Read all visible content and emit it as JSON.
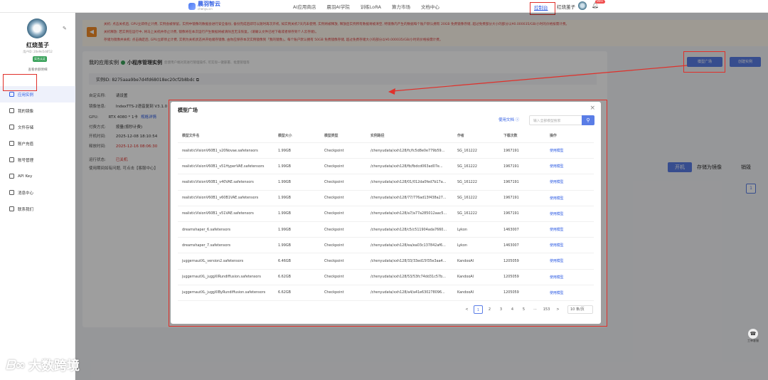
{
  "nav": {
    "logo_text": "晨羽智云",
    "logo_sub": "chenyu.cn",
    "links": [
      "AI应用商店",
      "晨羽AI学院",
      "训练LoRA",
      "算力市场",
      "文档中心"
    ],
    "console": "控制台",
    "username": "红烧茧子",
    "badge": "99+"
  },
  "sidebar": {
    "name": "红烧茧子",
    "user_id": "用户ID: 20e9e5d4f12",
    "tag": "实名认证",
    "link": "查看余额明细",
    "items": [
      {
        "label": "应用实例",
        "icon": "grid-icon",
        "active": true
      },
      {
        "label": "我的镜像",
        "icon": "box-icon"
      },
      {
        "label": "文件存储",
        "icon": "folder-icon"
      },
      {
        "label": "账户充值",
        "icon": "wallet-icon"
      },
      {
        "label": "账号管理",
        "icon": "user-icon"
      },
      {
        "label": "API Key",
        "icon": "key-icon"
      },
      {
        "label": "消息中心",
        "icon": "message-icon"
      },
      {
        "label": "联系我们",
        "icon": "contact-icon"
      }
    ]
  },
  "notice": {
    "lines": [
      "关机: 点击关机后, GPU立即停止计费, 实例会被保留。实例中镜像的数据会进行安全备份, 备份完成后即可以随时再次开机, 如实例关机7天内未使用, 实例将被释放, 释放后实例所有数据将被清空, 特镜像内产生的数据每个账户默认拥有 20GB 免费镜像存储, 超过免费部分大小的部分以¥0.000035/GB/小时的价格按需计费。",
      "关机释放: 若实例在运行中, 将马上关机并停止计费, 镜像将在本次运行产生数据将被清除且无法恢复。(请确认文件已经下载或者保存到个人云存储)。",
      "存储为镜像并关机: 点击确定后, GPU立即停止计费, 实例为关机状态并开始储存镜像, 由你应保存本次实例镜像到「我的镜像」。每个账户默认拥有 50GB 免费镜像存储, 超过免费存储大小的部分以¥0.000035/GB/小时的价格按需计费。"
    ]
  },
  "card": {
    "title": "我的应用实例",
    "mini": "小程序管理实例",
    "hint": "您使用户端对其进行管理操作, 可实现一键部署、批量管理等",
    "instance_label": "实例ID:",
    "instance_id": "8275aaa9be7d4fd68018ec20cf2b8bdc",
    "info": [
      {
        "label": "自定名称:",
        "value": "请设置"
      },
      {
        "label": "镜像信息:",
        "value": "IndexTTS-2语音复刻 V3.1.0"
      },
      {
        "label": "GPU:",
        "value": "RTX 4080 * 1卡",
        "link": "规格详情"
      },
      {
        "label": "付费方式:",
        "value": "按量(按秒计费)"
      },
      {
        "label": "开机时间:",
        "value": "2025-12-08 18:10:54"
      },
      {
        "label": "释放时间:",
        "value": "2025-12-16 08:06:30",
        "red": true
      },
      {
        "label": "运行状态:",
        "value": "已关机",
        "red": true
      }
    ],
    "help": "使用期间如有问题, 可点击【客服中心】",
    "btn_model": "模型广场",
    "btn_create": "创建实例",
    "btn_power": "开机",
    "btn_save": "存储为镜像",
    "btn_delete": "销毁",
    "page": "1"
  },
  "modal": {
    "title": "模型广场",
    "doc_link": "使用文档",
    "search_placeholder": "输入全部模型搜索",
    "columns": [
      "模型文件名",
      "模型大小",
      "模型类型",
      "实例路径",
      "作者",
      "下载次数",
      "操作"
    ],
    "rows": [
      [
        "realisticVisionV60B1_v20Novae.safetensors",
        "1.99GB",
        "Checkpoint",
        "/chenyudata/xxh128/fc/fc5d8e0e779b59...",
        "SG_161222",
        "1967191",
        "使用模型"
      ],
      [
        "realisticVisionV60B1_v51HyperVAE.safetensors",
        "1.99GB",
        "Checkpoint",
        "/chenyudata/xxh128/fb/fbdcd063ad07e...",
        "SG_161222",
        "1967191",
        "使用模型"
      ],
      [
        "realisticVisionV60B1_v40VAE.safetensors",
        "1.99GB",
        "Checkpoint",
        "/chenyudata/xxh128/01/012da0fed7b17a...",
        "SG_161222",
        "1967191",
        "使用模型"
      ],
      [
        "realisticVisionV60B1_v60B1VAE.safetensors",
        "1.99GB",
        "Checkpoint",
        "/chenyudata/xxh128/77/776ad13f438a27...",
        "SG_161222",
        "1967191",
        "使用模型"
      ],
      [
        "realisticVisionV60B1_v51VAE.safetensors",
        "1.99GB",
        "Checkpoint",
        "/chenyudata/xxh128/a7/a77a285012aac5...",
        "SG_161222",
        "1967191",
        "使用模型"
      ],
      [
        "dreamshaper_6.safetensors",
        "1.99GB",
        "Checkpoint",
        "/chenyudata/xxh128/c5/c511904ada7660...",
        "Lykon",
        "1463007",
        "使用模型"
      ],
      [
        "dreamshaper_7.safetensors",
        "1.99GB",
        "Checkpoint",
        "/chenyudata/xxh128/ea/ea03c137842af6...",
        "Lykon",
        "1463007",
        "使用模型"
      ],
      [
        "juggernautXL_version2.safetensors",
        "6.46GB",
        "Checkpoint",
        "/chenyudata/xxh128/33/33ed15f35e3aa4...",
        "KandooAI",
        "1205059",
        "使用模型"
      ],
      [
        "juggernautXL_juggXIRundiffusion.safetensors",
        "6.62GB",
        "Checkpoint",
        "/chenyudata/xxh128/53/53fc74dd31c57b...",
        "KandooAI",
        "1205059",
        "使用模型"
      ],
      [
        "juggernautXL_juggXIByRundiffusion.safetensors",
        "6.62GB",
        "Checkpoint",
        "/chenyudata/xxh128/a4/a41e630278096...",
        "KandooAI",
        "1205059",
        "使用模型"
      ]
    ],
    "pager": {
      "prev": "<",
      "pages": [
        "1",
        "2",
        "3",
        "4",
        "5"
      ],
      "ellipsis": "···",
      "last": "153",
      "next": ">",
      "size": "10 条/页"
    }
  },
  "watermark": "大数跨境",
  "help_text": "工单客服"
}
